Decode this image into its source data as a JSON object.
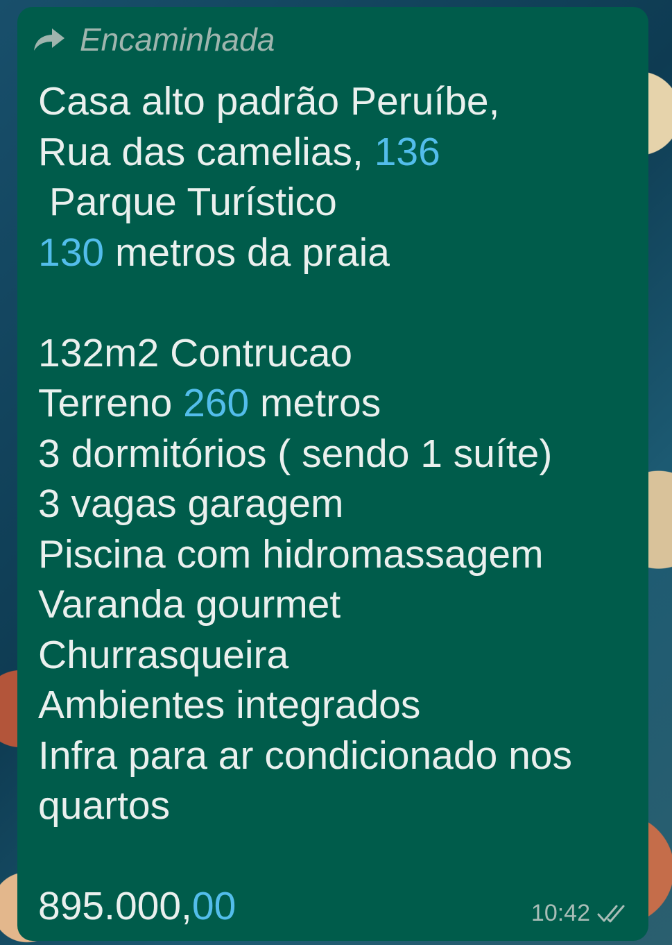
{
  "message": {
    "forwarded_label": "Encaminhada",
    "lines": [
      {
        "parts": [
          {
            "t": "Casa alto padrão Peruíbe,"
          }
        ]
      },
      {
        "parts": [
          {
            "t": "Rua das camelias, "
          },
          {
            "t": "136",
            "link": true
          }
        ]
      },
      {
        "parts": [
          {
            "t": " Parque Turístico"
          }
        ]
      },
      {
        "parts": [
          {
            "t": "130",
            "link": true
          },
          {
            "t": " metros da praia"
          }
        ]
      },
      {
        "parts": []
      },
      {
        "parts": [
          {
            "t": "132m2 Contrucao"
          }
        ]
      },
      {
        "parts": [
          {
            "t": "Terreno "
          },
          {
            "t": "260",
            "link": true
          },
          {
            "t": " metros"
          }
        ]
      },
      {
        "parts": [
          {
            "t": "3 dormitórios ( sendo 1 suíte)"
          }
        ]
      },
      {
        "parts": [
          {
            "t": "3 vagas garagem"
          }
        ]
      },
      {
        "parts": [
          {
            "t": "Piscina com hidromassagem"
          }
        ]
      },
      {
        "parts": [
          {
            "t": "Varanda gourmet"
          }
        ]
      },
      {
        "parts": [
          {
            "t": "Churrasqueira"
          }
        ]
      },
      {
        "parts": [
          {
            "t": "Ambientes integrados"
          }
        ]
      },
      {
        "parts": [
          {
            "t": "Infra para ar condicionado nos"
          }
        ]
      },
      {
        "parts": [
          {
            "t": "quartos"
          }
        ]
      },
      {
        "parts": []
      },
      {
        "parts": [
          {
            "t": "895.000,"
          },
          {
            "t": "00",
            "link": true
          }
        ]
      }
    ],
    "time": "10:42",
    "status_icon": "double-check-icon",
    "forward_icon": "forward-arrow-icon"
  },
  "colors": {
    "bubble": "#005c4b",
    "text": "#eaf0ee",
    "link": "#53bdeb",
    "meta": "#a9bdb7"
  }
}
